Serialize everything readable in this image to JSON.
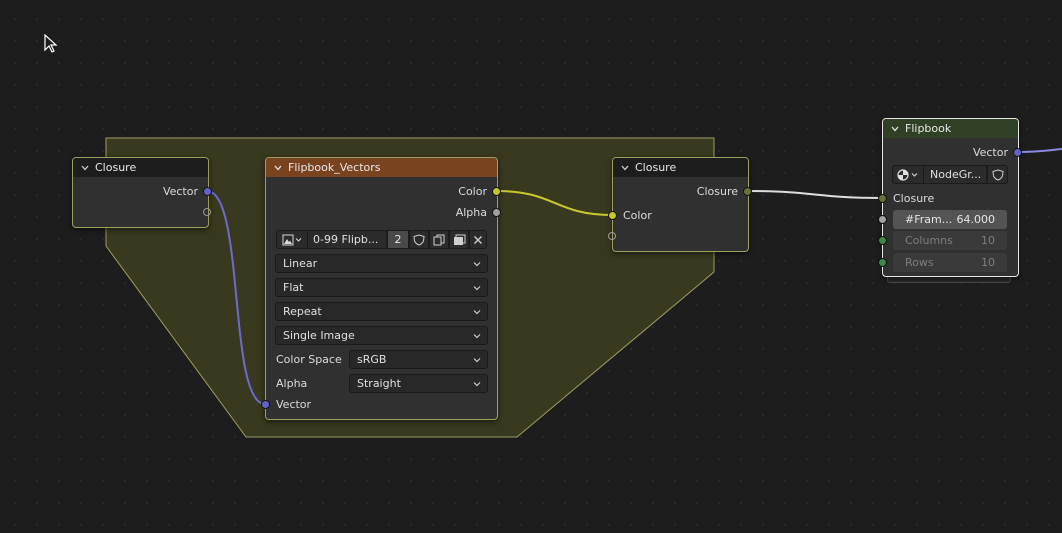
{
  "colors": {
    "background": "#1d1d1d",
    "frame_fill": "#39391f",
    "frame_border": "#9d9d5e",
    "vector_socket": "#6363c7",
    "color_socket": "#c7c729",
    "closure_socket": "#6a7036",
    "float_socket": "#a1a1a1",
    "int_socket": "#3d8a47",
    "image_header": "#7a4320",
    "group_header": "#2f4024"
  },
  "closure_left": {
    "title": "Closure",
    "output_vector": "Vector"
  },
  "flipbook_vectors": {
    "title": "Flipbook_Vectors",
    "output_color": "Color",
    "output_alpha": "Alpha",
    "image_name": "0-99 Flipb...",
    "users": "2",
    "interpolation": "Linear",
    "projection": "Flat",
    "extension": "Repeat",
    "source": "Single Image",
    "color_space_label": "Color Space",
    "color_space_value": "sRGB",
    "alpha_label": "Alpha",
    "alpha_value": "Straight",
    "input_vector": "Vector"
  },
  "closure_right": {
    "title": "Closure",
    "output_closure": "Closure",
    "input_color": "Color"
  },
  "flipbook_group": {
    "title": "Flipbook",
    "output_vector": "Vector",
    "group_name": "NodeGr...",
    "input_closure": "Closure",
    "frame_label": "#Fram...",
    "frame_value": "64.000",
    "columns_label": "Columns",
    "columns_value": "10",
    "rows_label": "Rows",
    "rows_value": "10"
  }
}
